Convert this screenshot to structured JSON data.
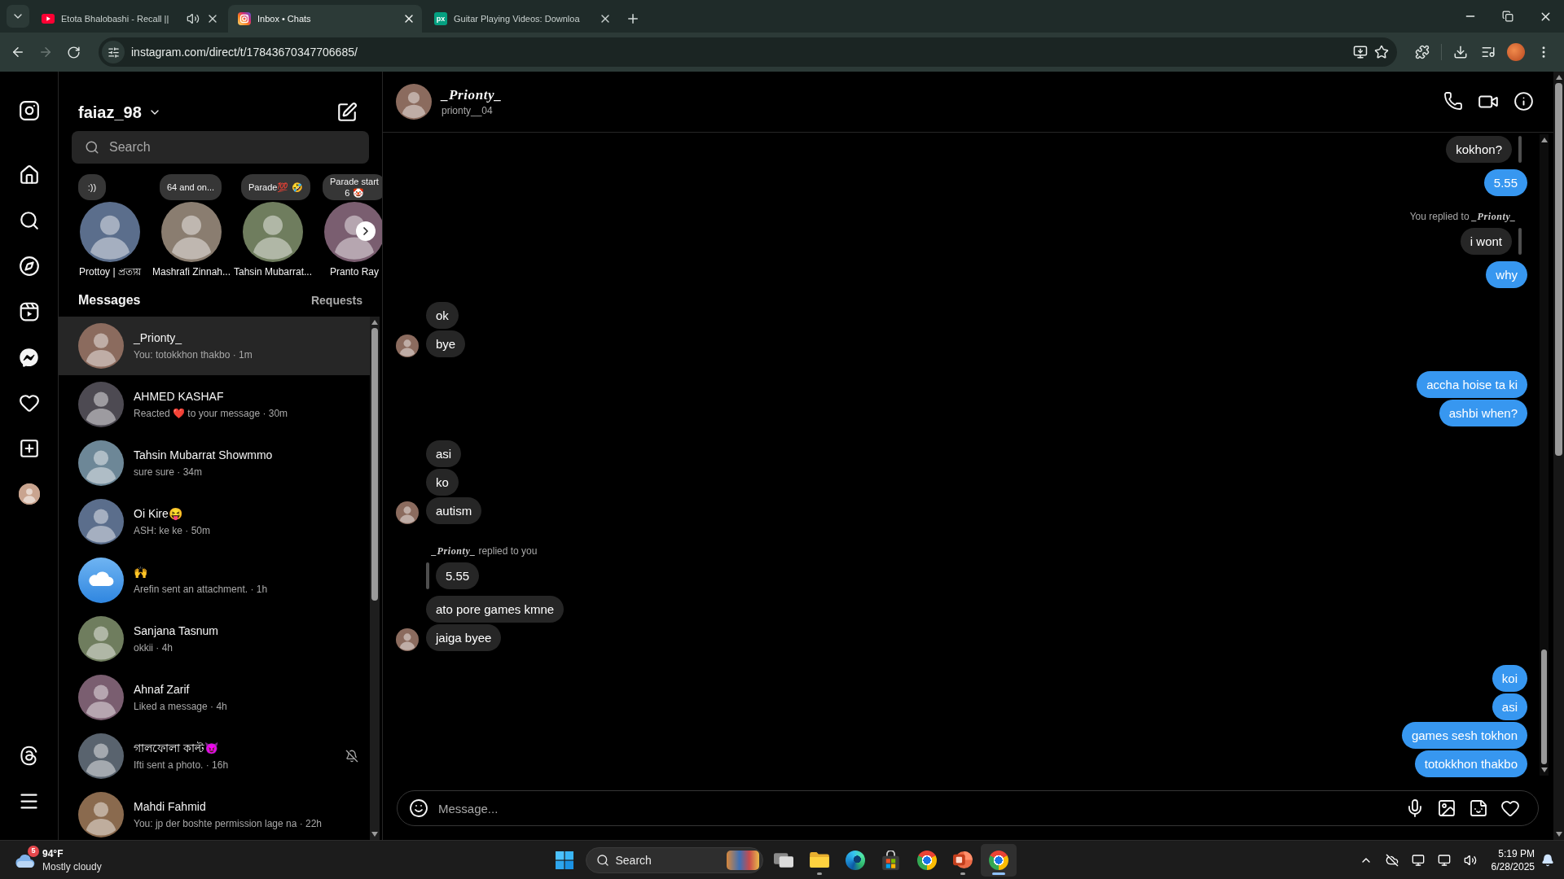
{
  "browser": {
    "tabs": [
      {
        "title": "Etota Bhalobashi - Recall ||",
        "kind": "video",
        "audio": true,
        "selected": false
      },
      {
        "title": "Inbox • Chats",
        "kind": "camera",
        "audio": false,
        "selected": true
      },
      {
        "title": "Guitar Playing Videos: Downloa",
        "kind": "lettermark",
        "icon_text": "px",
        "audio": false,
        "selected": false
      }
    ],
    "nav": [
      {
        "kind": "back",
        "disabled": false
      },
      {
        "kind": "forward",
        "disabled": true
      },
      {
        "kind": "reload",
        "disabled": false
      }
    ],
    "url": "instagram.com/direct/t/17843670347706685/"
  },
  "sidebar": {
    "items": [
      {
        "kind": "home",
        "selected": false
      },
      {
        "kind": "search",
        "selected": false
      },
      {
        "kind": "explore",
        "selected": false
      },
      {
        "kind": "reels",
        "selected": false
      },
      {
        "kind": "messages",
        "selected": true
      },
      {
        "kind": "notifications",
        "selected": false
      },
      {
        "kind": "create",
        "selected": false
      },
      {
        "kind": "profile",
        "selected": false
      }
    ],
    "bottom": [
      {
        "kind": "threads"
      },
      {
        "kind": "more"
      }
    ]
  },
  "inbox": {
    "username": "faiaz_98",
    "search": {
      "placeholder": "Search"
    },
    "notes": [
      {
        "note": ":))",
        "name": "Prottoy | প্রত্যয়"
      },
      {
        "note": "64 and on...",
        "name": "Mashrafi Zinnah..."
      },
      {
        "note": "Parade💯 🤣",
        "name": "Tahsin Mubarrat..."
      },
      {
        "note": "Parade start\n6 🤡",
        "name": "Pranto Ray"
      }
    ],
    "heading": "Messages",
    "requests": "Requests",
    "conversations": [
      {
        "name": "_Prionty_",
        "preview": "You: totokkhon thakbo · 1m",
        "kind": "photo",
        "selected": true,
        "muted": false
      },
      {
        "name": "AHMED KASHAF",
        "preview": "Reacted ❤️ to your message · 30m",
        "kind": "photo",
        "selected": false,
        "muted": false
      },
      {
        "name": "Tahsin Mubarrat Showmmo",
        "preview": "sure sure · 34m",
        "kind": "photo",
        "selected": false,
        "muted": false
      },
      {
        "name": "Oi Kire😝",
        "preview": "ASH: ke ke · 50m",
        "kind": "photo",
        "selected": false,
        "muted": false
      },
      {
        "name": "🙌",
        "preview": "Arefin sent an attachment. · 1h",
        "kind": "default",
        "selected": false,
        "muted": false
      },
      {
        "name": "Sanjana Tasnum",
        "preview": "okkii · 4h",
        "kind": "photo",
        "selected": false,
        "muted": false
      },
      {
        "name": "Ahnaf Zarif",
        "preview": "Liked a message · 4h",
        "kind": "photo",
        "selected": false,
        "muted": false
      },
      {
        "name": "গালফোলা কাল্ট😈",
        "preview": "Ifti sent a photo. · 16h",
        "kind": "photo",
        "selected": false,
        "muted": true
      },
      {
        "name": "Mahdi Fahmid",
        "preview": "You: jp der boshte permission lage na · 22h",
        "kind": "photo",
        "selected": false,
        "muted": false
      }
    ]
  },
  "chat": {
    "name": "_Prionty_",
    "username": "prionty__04",
    "groups": [
      {
        "kind": "outgoing",
        "items": [
          {
            "kind": "quote",
            "text": "kokhon?"
          },
          {
            "kind": "text",
            "text": "5.55"
          }
        ]
      },
      {
        "kind": "outgoing",
        "items": [
          {
            "kind": "reply_note",
            "label": "You replied to",
            "name": "_Prionty_"
          },
          {
            "kind": "quote",
            "text": "i wont"
          },
          {
            "kind": "text",
            "text": "why"
          }
        ]
      },
      {
        "kind": "incoming",
        "items": [
          {
            "kind": "text",
            "text": "ok"
          },
          {
            "kind": "text",
            "text": "bye"
          }
        ]
      },
      {
        "kind": "outgoing",
        "items": [
          {
            "kind": "text",
            "text": "accha hoise ta ki"
          },
          {
            "kind": "text",
            "text": "ashbi when?"
          }
        ]
      },
      {
        "kind": "incoming",
        "items": [
          {
            "kind": "text",
            "text": "asi"
          },
          {
            "kind": "text",
            "text": "ko"
          },
          {
            "kind": "text",
            "text": "autism"
          }
        ]
      },
      {
        "kind": "incoming",
        "items": [
          {
            "kind": "reply_note",
            "name": "_Prionty_",
            "label": "replied to you"
          },
          {
            "kind": "quote",
            "text": "5.55"
          },
          {
            "kind": "text",
            "text": "ato pore games kmne"
          },
          {
            "kind": "text",
            "text": "jaiga byee"
          }
        ]
      },
      {
        "kind": "outgoing",
        "items": [
          {
            "kind": "text",
            "text": "koi"
          },
          {
            "kind": "text",
            "text": "asi"
          },
          {
            "kind": "text",
            "text": "games sesh tokhon"
          },
          {
            "kind": "text",
            "text": "totokkhon thakbo"
          }
        ]
      }
    ],
    "composer": {
      "placeholder": "Message..."
    }
  },
  "taskbar": {
    "weather": {
      "badge": "5",
      "temperature": "94°F",
      "condition": "Mostly cloudy"
    },
    "search": {
      "label": "Search"
    },
    "apps": [
      {
        "kind": "task_view",
        "running": false,
        "selected": false
      },
      {
        "kind": "files",
        "running": true,
        "selected": false
      },
      {
        "kind": "edge",
        "running": false,
        "selected": false
      },
      {
        "kind": "store",
        "running": false,
        "selected": false
      },
      {
        "kind": "chrome",
        "running": false,
        "selected": false
      },
      {
        "kind": "slides",
        "running": true,
        "selected": false
      },
      {
        "kind": "chrome",
        "running": true,
        "selected": true
      }
    ],
    "time": "5:19 PM",
    "date": "6/28/2025"
  }
}
